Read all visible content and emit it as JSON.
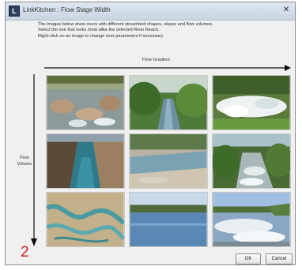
{
  "window": {
    "title": "LinkKitchen : Flow Stage Width",
    "close_symbol": "✕"
  },
  "instructions": [
    "The images below show rivers with different streambed shapes, slopes and flow volumes.",
    "Select the one that looks most alike the selected River Reach.",
    "Right-click on an image to change river parameters if necessary."
  ],
  "axes": {
    "horizontal_label": "Flow Gradient",
    "vertical_label_line1": "Flow",
    "vertical_label_line2": "Volume"
  },
  "images": [
    {
      "icon": "rocky-rapids-photo"
    },
    {
      "icon": "green-forest-stream-photo"
    },
    {
      "icon": "whitewater-cascade-photo"
    },
    {
      "icon": "canyon-river-photo"
    },
    {
      "icon": "gravel-bed-river-photo"
    },
    {
      "icon": "forest-rapids-photo"
    },
    {
      "icon": "aerial-braided-river-photo"
    },
    {
      "icon": "wide-calm-river-photo"
    },
    {
      "icon": "large-rapids-photo"
    }
  ],
  "buttons": {
    "ok": "OK",
    "cancel": "Cancel"
  },
  "annotation": {
    "number": "2",
    "color": "#d2231f"
  }
}
